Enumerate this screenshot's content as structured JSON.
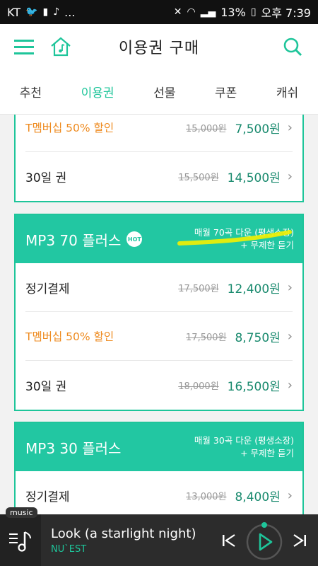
{
  "status_bar": {
    "carrier": "KT",
    "dots": "...",
    "battery": "13%",
    "time": "오후 7:39"
  },
  "header": {
    "title": "이용권 구매"
  },
  "tabs": [
    {
      "label": "추천"
    },
    {
      "label": "이용권",
      "active": true
    },
    {
      "label": "선물"
    },
    {
      "label": "쿠폰"
    },
    {
      "label": "캐쉬"
    }
  ],
  "card0": {
    "rows": [
      {
        "label": "T멤버십 50% 할인",
        "original": "15,000원",
        "price": "7,500원"
      },
      {
        "label": "30일 권",
        "original": "15,500원",
        "price": "14,500원"
      }
    ]
  },
  "card1": {
    "title": "MP3 70 플러스",
    "badge": "HOT",
    "desc1": "매월 70곡 다운 (평생소장)",
    "desc2": "+ 무제한 듣기",
    "rows": [
      {
        "label": "정기결제",
        "original": "17,500원",
        "price": "12,400원"
      },
      {
        "label": "T멤버십 50% 할인",
        "original": "17,500원",
        "price": "8,750원"
      },
      {
        "label": "30일 권",
        "original": "18,000원",
        "price": "16,500원"
      }
    ]
  },
  "card2": {
    "title": "MP3 30 플러스",
    "desc1": "매월 30곡 다운 (평생소장)",
    "desc2": "+ 무제한 듣기",
    "rows": [
      {
        "label": "정기결제",
        "original": "13,000원",
        "price": "8,400원"
      }
    ]
  },
  "player": {
    "tag": "music",
    "title": "Look (a starlight night)",
    "artist": "NU`EST"
  },
  "colors": {
    "accent": "#1ec59a",
    "header_band": "#22c7a2",
    "discount": "#ee8a1e",
    "highlight": "#f4f000"
  }
}
